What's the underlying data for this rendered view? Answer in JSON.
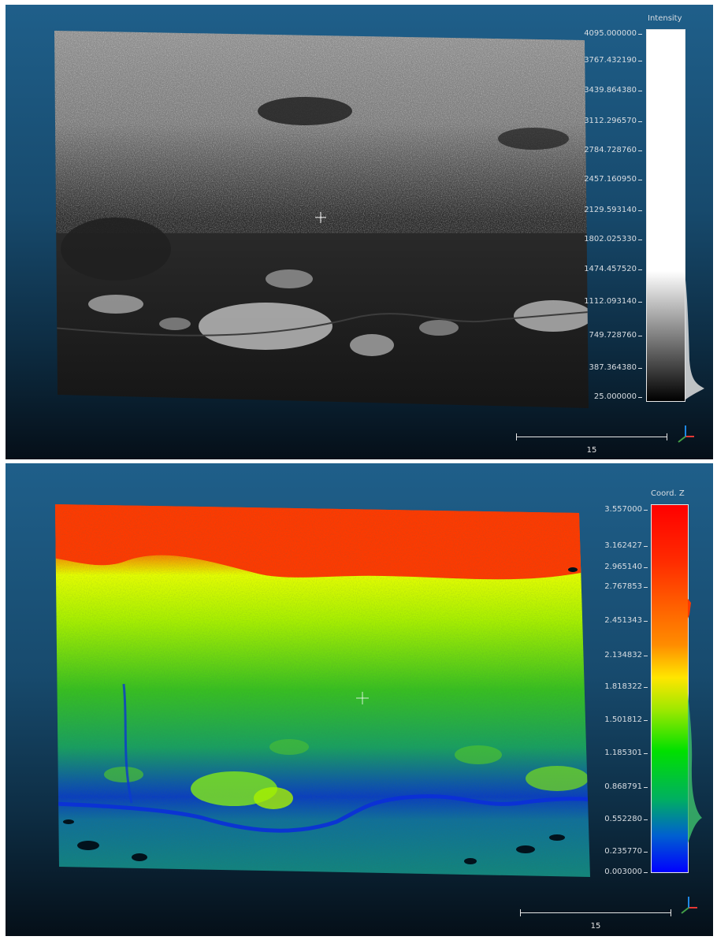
{
  "top_view": {
    "scalar_field": "Intensity",
    "color_scale": "grey",
    "ticks": [
      "4095.000000",
      "3767.432190",
      "3439.864380",
      "3112.296570",
      "2784.728760",
      "2457.160950",
      "2129.593140",
      "1802.025330",
      "1474.457520",
      "1112.093140",
      "749.728760",
      "387.364380",
      "25.000000"
    ],
    "scale_label": "15"
  },
  "bottom_view": {
    "scalar_field": "Coord. Z",
    "color_scale": "blue-green-yellow-red",
    "ticks": [
      "3.557000",
      "3.162427",
      "2.965140",
      "2.767853",
      "2.451343",
      "2.134832",
      "1.818322",
      "1.501812",
      "1.185301",
      "0.868791",
      "0.552280",
      "0.235770",
      "0.003000"
    ],
    "scale_label": "15"
  },
  "colors": {
    "background_top": "#1f5f8a",
    "background_bottom": "#050f18",
    "axis_x": "#e53935",
    "axis_y": "#43a047",
    "axis_z": "#1e88e5"
  },
  "icons": {
    "axis_triad": "xyz-axis-icon",
    "pivot": "crosshair-icon"
  }
}
